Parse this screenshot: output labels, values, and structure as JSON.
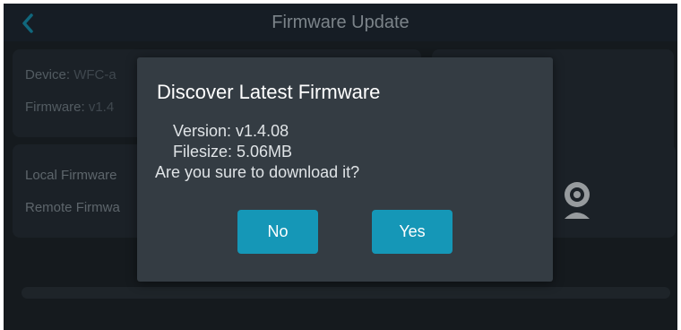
{
  "header": {
    "title": "Firmware Update",
    "back_icon": "chevron-left-icon"
  },
  "device_card": {
    "device_label": "Device:",
    "device_value": "WFC-a",
    "firmware_label": "Firmware:",
    "firmware_value": "v1.4"
  },
  "firmware_card": {
    "local_label": "Local Firmware",
    "remote_label": "Remote Firmwa"
  },
  "camera_icon": "webcam-icon",
  "dialog": {
    "title": "Discover Latest Firmware",
    "version": "Version: v1.4.08",
    "filesize": "Filesize: 5.06MB",
    "question": "Are you sure to download it?",
    "no_label": "No",
    "yes_label": "Yes"
  },
  "colors": {
    "accent": "#1597b7",
    "background": "#1c2126",
    "card": "#252c33",
    "dialog": "#343c43"
  }
}
